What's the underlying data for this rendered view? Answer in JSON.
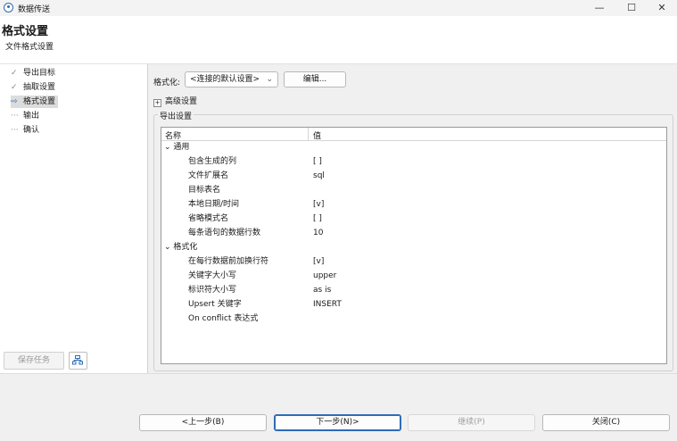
{
  "window": {
    "title": "数据传送",
    "minimize": "—",
    "maximize": "☐",
    "close": "✕"
  },
  "header": {
    "title": "格式设置",
    "subtitle": "文件格式设置"
  },
  "steps": [
    {
      "mark": "✓",
      "label": "导出目标"
    },
    {
      "mark": "✓",
      "label": "抽取设置"
    },
    {
      "mark": "⇨",
      "label": "格式设置"
    },
    {
      "mark": "···",
      "label": "输出"
    },
    {
      "mark": "···",
      "label": "确认"
    }
  ],
  "left_footer": {
    "save_task_label": "保存任务"
  },
  "format": {
    "label": "格式化:",
    "selected": "<连接的默认设置>",
    "caret": "⌄",
    "edit_label": "编辑..."
  },
  "advanced": {
    "toggle": "+",
    "label": "高级设置"
  },
  "export_settings": {
    "label": "导出设置",
    "columns": [
      "名称",
      "值"
    ],
    "categories": [
      {
        "name": "通用",
        "arrow": "⌄",
        "rows": [
          {
            "name": "包含生成的列",
            "value": "[ ]"
          },
          {
            "name": "文件扩展名",
            "value": "sql"
          },
          {
            "name": "目标表名",
            "value": ""
          },
          {
            "name": "本地日期/时间",
            "value": "[v]"
          },
          {
            "name": "省略模式名",
            "value": "[ ]"
          },
          {
            "name": "每条语句的数据行数",
            "value": "10"
          }
        ]
      },
      {
        "name": "格式化",
        "arrow": "⌄",
        "rows": [
          {
            "name": "在每行数据前加换行符",
            "value": "[v]"
          },
          {
            "name": "关键字大小写",
            "value": "upper"
          },
          {
            "name": "标识符大小写",
            "value": "as is"
          },
          {
            "name": "Upsert 关键字",
            "value": "INSERT"
          },
          {
            "name": "On conflict 表达式",
            "value": ""
          }
        ]
      }
    ]
  },
  "footer": {
    "back": "<上一步(B)",
    "next": "下一步(N)>",
    "continue": "继续(P)",
    "close": "关闭(C)"
  }
}
